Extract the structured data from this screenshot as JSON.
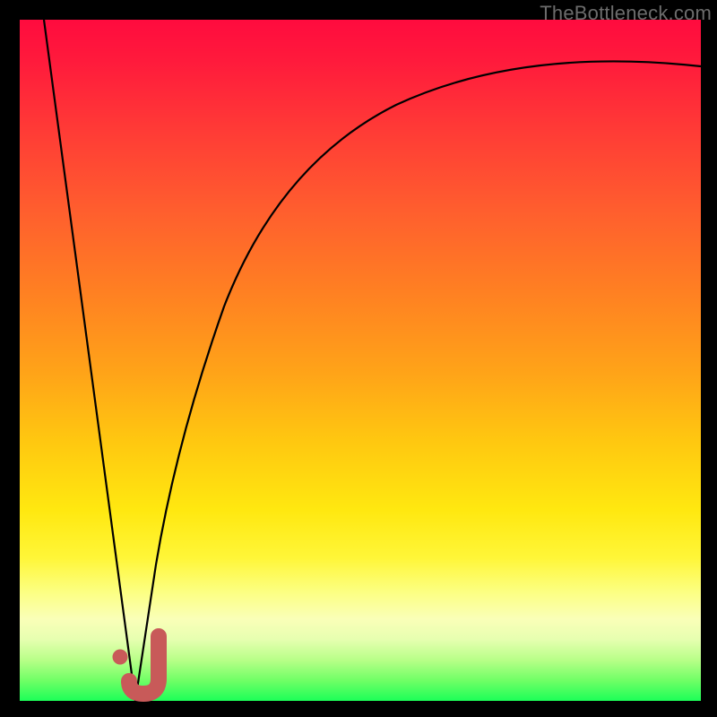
{
  "watermark": "TheBottleneck.com",
  "chart_data": {
    "type": "line",
    "title": "",
    "xlabel": "",
    "ylabel": "",
    "xlim": [
      0,
      100
    ],
    "ylim": [
      0,
      100
    ],
    "grid": false,
    "background": "gradient red-to-green (top-to-bottom)",
    "series": [
      {
        "name": "left-branch",
        "x": [
          3.5,
          17
        ],
        "y": [
          100,
          0
        ]
      },
      {
        "name": "right-branch",
        "x": [
          17,
          20,
          24,
          30,
          38,
          50,
          65,
          80,
          100
        ],
        "y": [
          0,
          20,
          40,
          58,
          70,
          79,
          85,
          89,
          93
        ]
      }
    ],
    "annotations": [
      {
        "name": "j-marker",
        "x": 18.5,
        "y": 5,
        "shape": "J",
        "color": "#c85a59"
      },
      {
        "name": "j-dot",
        "x": 14.8,
        "y": 6.5,
        "shape": "dot",
        "color": "#c85a59"
      }
    ]
  }
}
